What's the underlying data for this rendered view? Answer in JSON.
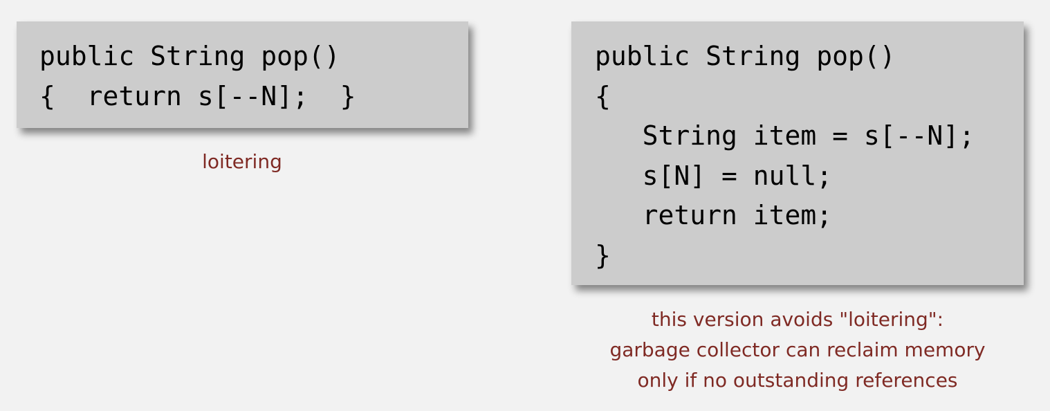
{
  "left_panel": {
    "code_lines": [
      "public String pop()",
      "{  return s[--N];  }"
    ],
    "caption": "loitering"
  },
  "right_panel": {
    "code_lines": [
      "public String pop()",
      "{",
      "   String item = s[--N];",
      "   s[N] = null;",
      "   return item;",
      "}"
    ],
    "caption_lines": [
      "this version avoids \"loitering\":",
      "garbage collector can reclaim memory",
      "only if no outstanding references"
    ]
  },
  "colors": {
    "background": "#f2f2f2",
    "code_box": "#cccccc",
    "caption_text": "#7f2a24",
    "code_text": "#000000"
  }
}
